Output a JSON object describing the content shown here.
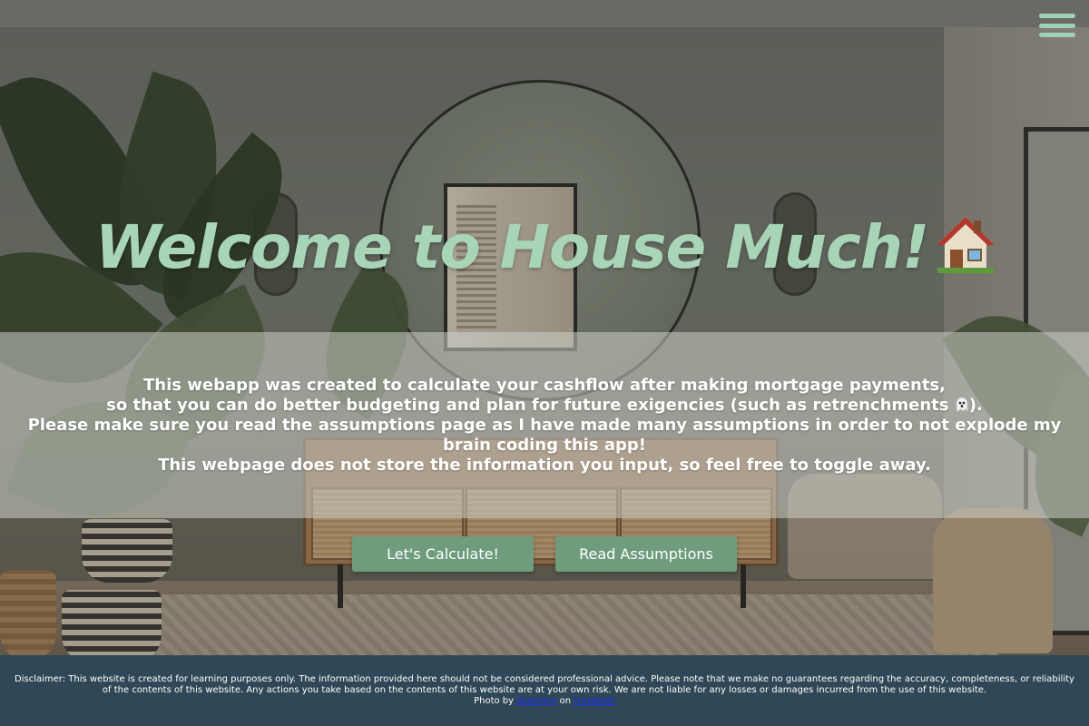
{
  "header": {
    "menu_icon": "hamburger-menu-icon",
    "menu_color": "#9fd1b5"
  },
  "hero": {
    "title": "Welcome to House Much!",
    "title_icon": "house-icon",
    "title_color": "#a8d4b8"
  },
  "intro": {
    "line1": "This webapp was created to calculate your cashflow after making mortgage payments,",
    "line2_before": "so that you can do better budgeting and plan for future exigencies (such as retrenchments",
    "line2_icon": "ghost-icon",
    "line2_after": ").",
    "line3": "Please make sure you read the assumptions page as I have made many assumptions in order to not explode my brain coding this app!",
    "line4": "This webpage does not store the information you input, so feel free to toggle away."
  },
  "actions": {
    "calculate_label": "Let's Calculate!",
    "assumptions_label": "Read Assumptions",
    "button_color": "#6f9c7d"
  },
  "footer": {
    "disclaimer": "Disclaimer: This website is created for learning purposes only. The information provided here should not be considered professional advice. Please note that we make no guarantees regarding the accuracy, completeness, or reliability of the contents of this website. Any actions you take based on the contents of this website are at your own risk. We are not liable for any losses or damages incurred from the use of this website.",
    "credit_prefix": "Photo by",
    "photographer": "spacejoy",
    "credit_middle": "on",
    "platform": "Unsplash",
    "background_color": "#2f4756"
  }
}
